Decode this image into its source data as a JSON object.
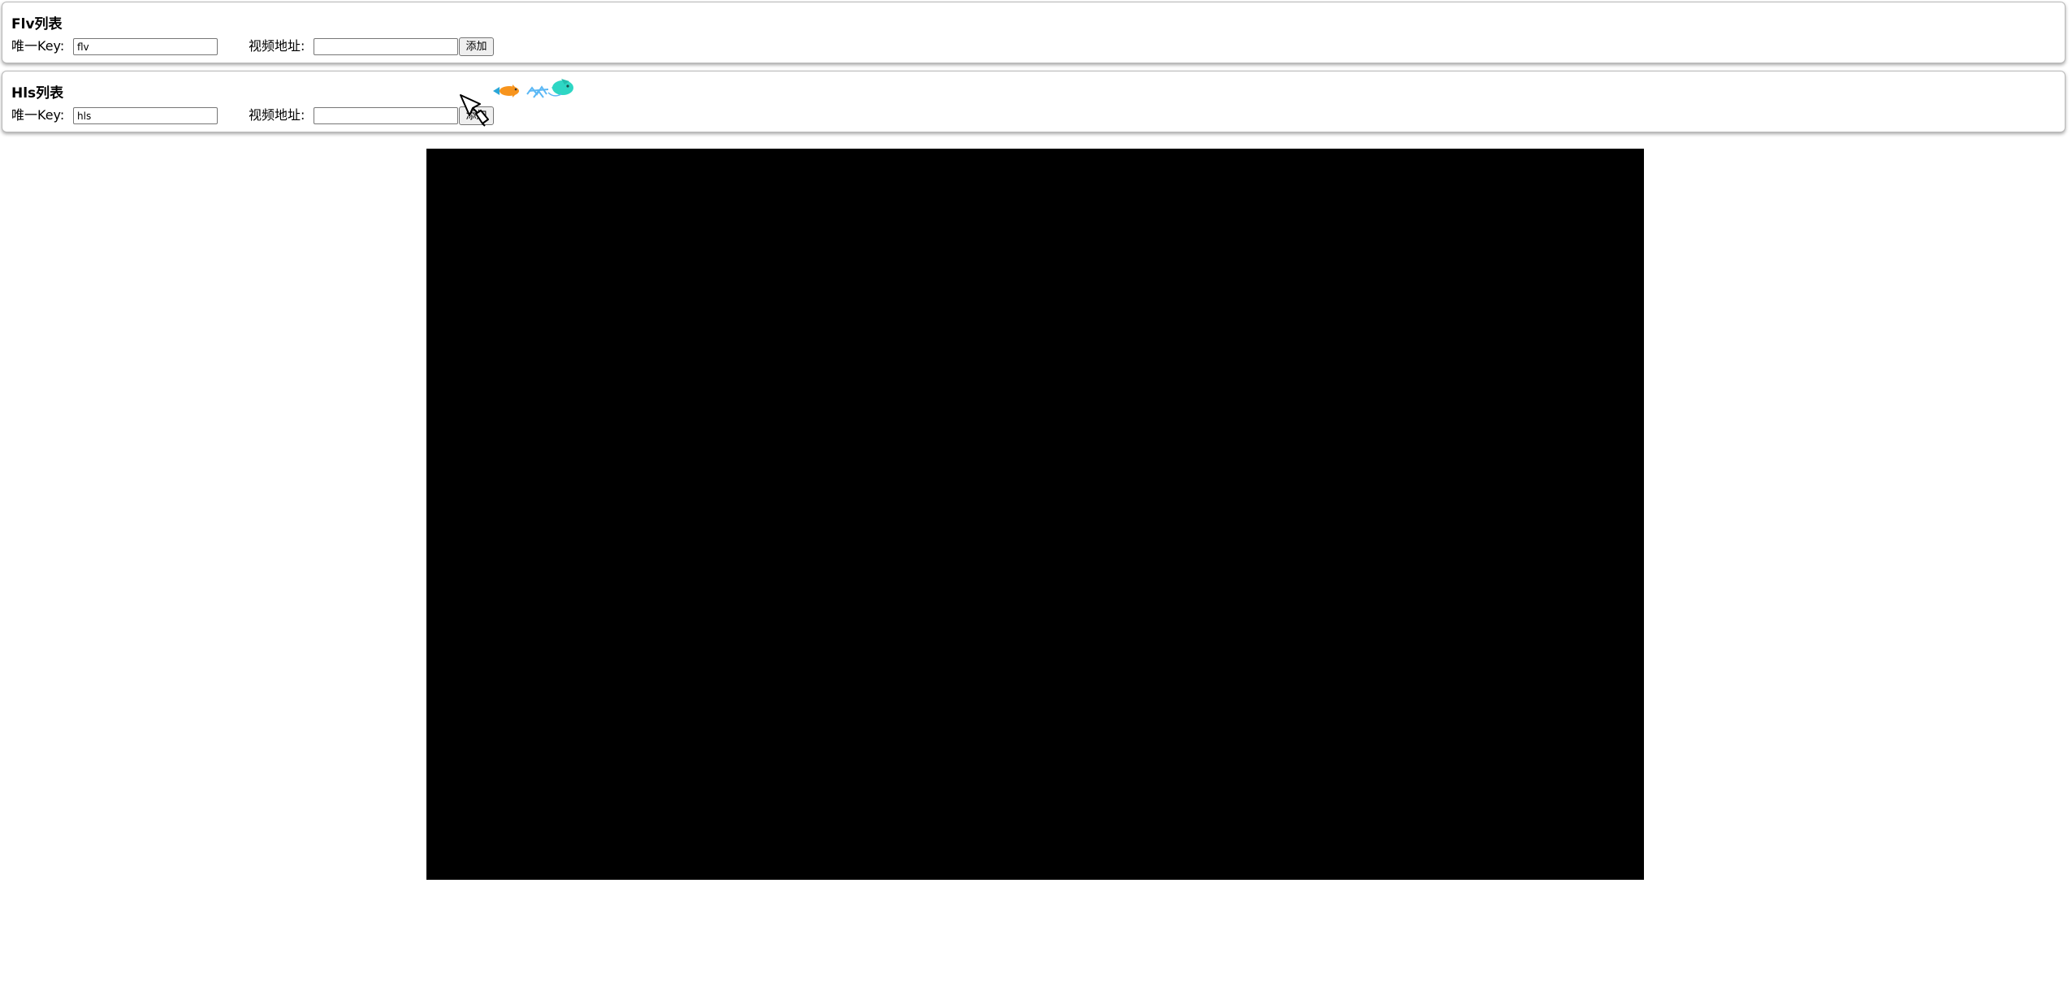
{
  "flv_panel": {
    "title": "Flv列表",
    "key_label": "唯一Key:",
    "key_value": "flv",
    "url_label": "视频地址:",
    "url_value": "",
    "add_label": "添加"
  },
  "hls_panel": {
    "title": "Hls列表",
    "key_label": "唯一Key:",
    "key_value": "hls",
    "url_label": "视频地址:",
    "url_value": "",
    "add_label": "添加"
  },
  "icons": {
    "cursor": "hand-pen-cursor-icon",
    "fish_trail": "fish-trail-icon"
  },
  "colors": {
    "video_background": "#000000",
    "panel_border": "#b9b9b9",
    "fish_orange": "#f7941d",
    "fish_blue": "#5bb8f5",
    "fish_teal": "#2ed6c4"
  }
}
